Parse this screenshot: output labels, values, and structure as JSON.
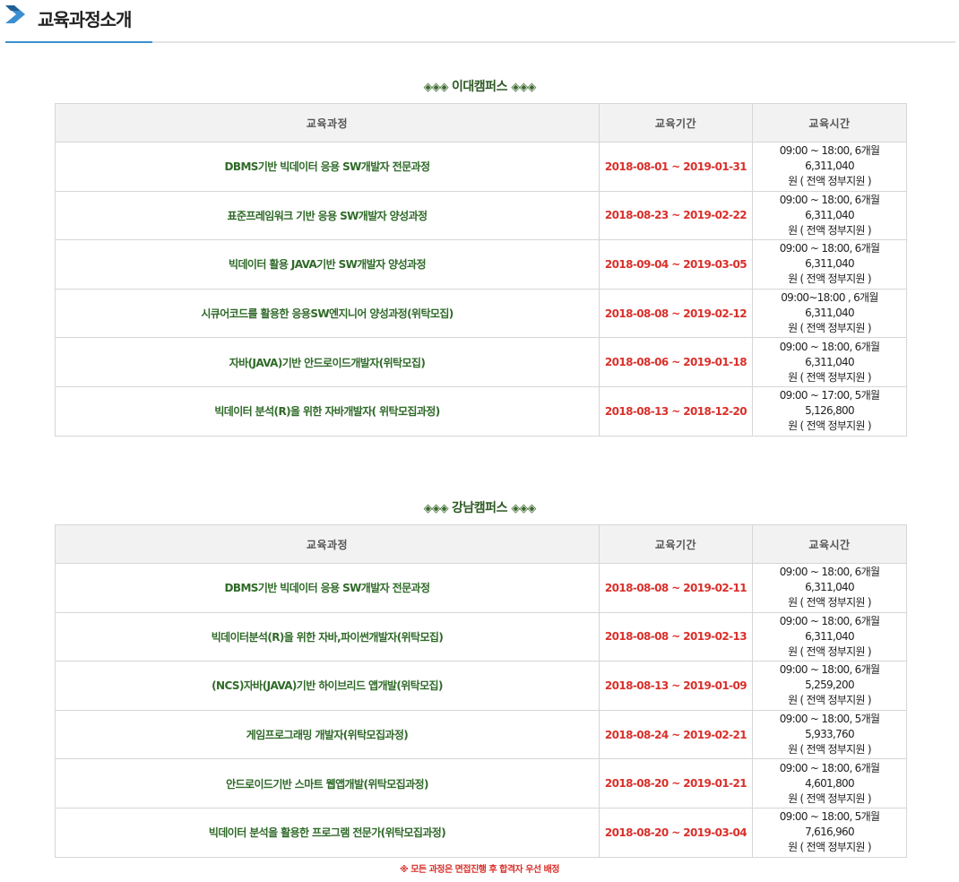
{
  "header": {
    "title": "교육과정소개",
    "accent_color": "#3a8fd0"
  },
  "columns": {
    "course": "교육과정",
    "period": "교육기간",
    "time": "교육시간"
  },
  "sections": [
    {
      "decor_left": "◈◈◈",
      "name": "이대캠퍼스",
      "decor_right": "◈◈◈",
      "rows": [
        {
          "course": "DBMS기반 빅데이터 응용 SW개발자 전문과정",
          "period": "2018-08-01 ~ 2019-01-31",
          "time_line1": "09:00 ~ 18:00, 6개월 6,311,040",
          "time_line2": "원 ( 전액 정부지원 )"
        },
        {
          "course": "표준프레임워크 기반 응용 SW개발자 양성과정",
          "period": "2018-08-23 ~ 2019-02-22",
          "time_line1": "09:00 ~ 18:00, 6개월 6,311,040",
          "time_line2": "원 ( 전액 정부지원 )"
        },
        {
          "course": "빅데이터 활용 JAVA기반 SW개발자 양성과정",
          "period": "2018-09-04 ~ 2019-03-05",
          "time_line1": "09:00 ~ 18:00, 6개월 6,311,040",
          "time_line2": "원 ( 전액 정부지원 )"
        },
        {
          "course": "시큐어코드를 활용한 응용SW엔지니어 양성과정(위탁모집)",
          "period": "2018-08-08 ~ 2019-02-12",
          "time_line1": "09:00~18:00 , 6개월 6,311,040",
          "time_line2": "원 ( 전액 정부지원 )"
        },
        {
          "course": "자바(JAVA)기반 안드로이드개발자(위탁모집)",
          "period": "2018-08-06 ~ 2019-01-18",
          "time_line1": "09:00 ~ 18:00, 6개월 6,311,040",
          "time_line2": "원 ( 전액 정부지원 )"
        },
        {
          "course": "빅데이터 분석(R)을 위한 자바개발자( 위탁모집과정)",
          "period": "2018-08-13 ~ 2018-12-20",
          "time_line1": "09:00 ~ 17:00, 5개월 5,126,800",
          "time_line2": "원 ( 전액 정부지원 )"
        }
      ]
    },
    {
      "decor_left": "◈◈◈",
      "name": "강남캠퍼스",
      "decor_right": "◈◈◈",
      "rows": [
        {
          "course": "DBMS기반 빅데이터 응용 SW개발자 전문과정",
          "period": "2018-08-08 ~ 2019-02-11",
          "time_line1": "09:00 ~ 18:00, 6개월 6,311,040",
          "time_line2": "원 ( 전액 정부지원 )"
        },
        {
          "course": "빅데이터분석(R)을 위한 자바,파이썬개발자(위탁모집)",
          "period": "2018-08-08 ~ 2019-02-13",
          "time_line1": "09:00 ~ 18:00, 6개월 6,311,040",
          "time_line2": "원 ( 전액 정부지원 )"
        },
        {
          "course": "(NCS)자바(JAVA)기반 하이브리드 앱개발(위탁모집)",
          "period": "2018-08-13 ~ 2019-01-09",
          "time_line1": "09:00 ~ 18:00, 6개월 5,259,200",
          "time_line2": "원 ( 전액 정부지원 )"
        },
        {
          "course": "게임프로그래밍 개발자(위탁모집과정)",
          "period": "2018-08-24 ~ 2019-02-21",
          "time_line1": "09:00 ~ 18:00, 5개월 5,933,760",
          "time_line2": "원 ( 전액 정부지원 )"
        },
        {
          "course": "안드로이드기반 스마트 웹앱개발(위탁모집과정)",
          "period": "2018-08-20 ~ 2019-01-21",
          "time_line1": "09:00 ~ 18:00, 6개월 4,601,800",
          "time_line2": "원 ( 전액 정부지원 )"
        },
        {
          "course": "빅데이터 분석을 활용한 프로그램 전문가(위탁모집과정)",
          "period": "2018-08-20 ~ 2019-03-04",
          "time_line1": "09:00 ~ 18:00, 5개월 7,616,960",
          "time_line2": "원 ( 전액 정부지원 )"
        }
      ]
    }
  ],
  "footnote": "※ 모든 과정은 면접진행 후 합격자 우선 배정"
}
